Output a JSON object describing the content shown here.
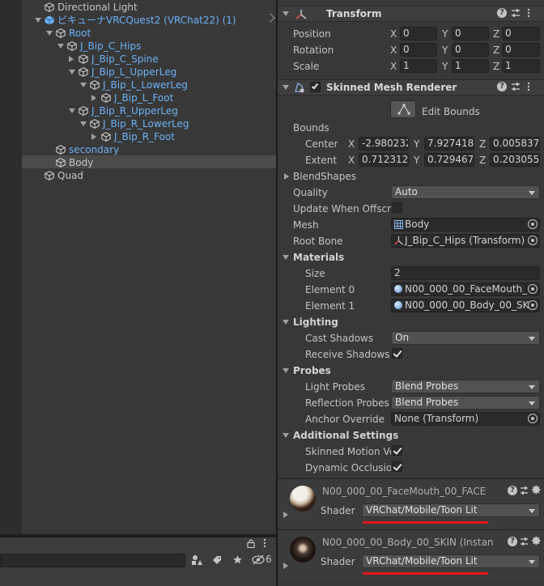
{
  "hierarchy": {
    "items": [
      {
        "label": "Directional Light",
        "depth": 0,
        "arrow": "none",
        "blue": false,
        "prefab": false,
        "selected": false
      },
      {
        "label": "ビキューナVRCQuest2 (VRChat22) (1)",
        "depth": 0,
        "arrow": "down",
        "blue": true,
        "prefab": true,
        "selected": false
      },
      {
        "label": "Root",
        "depth": 1,
        "arrow": "down",
        "blue": true,
        "prefab": false,
        "selected": false
      },
      {
        "label": "J_Bip_C_Hips",
        "depth": 2,
        "arrow": "down",
        "blue": true,
        "prefab": false,
        "selected": false
      },
      {
        "label": "J_Bip_C_Spine",
        "depth": 3,
        "arrow": "right",
        "blue": true,
        "prefab": false,
        "selected": false
      },
      {
        "label": "J_Bip_L_UpperLeg",
        "depth": 3,
        "arrow": "down",
        "blue": true,
        "prefab": false,
        "selected": false
      },
      {
        "label": "J_Bip_L_LowerLeg",
        "depth": 4,
        "arrow": "down",
        "blue": true,
        "prefab": false,
        "selected": false
      },
      {
        "label": "J_Bip_L_Foot",
        "depth": 5,
        "arrow": "right",
        "blue": true,
        "prefab": false,
        "selected": false
      },
      {
        "label": "J_Bip_R_UpperLeg",
        "depth": 3,
        "arrow": "down",
        "blue": true,
        "prefab": false,
        "selected": false
      },
      {
        "label": "J_Bip_R_LowerLeg",
        "depth": 4,
        "arrow": "down",
        "blue": true,
        "prefab": false,
        "selected": false
      },
      {
        "label": "J_Bip_R_Foot",
        "depth": 5,
        "arrow": "right",
        "blue": true,
        "prefab": false,
        "selected": false
      },
      {
        "label": "secondary",
        "depth": 1,
        "arrow": "none",
        "blue": true,
        "prefab": false,
        "selected": false
      },
      {
        "label": "Body",
        "depth": 1,
        "arrow": "none",
        "blue": false,
        "prefab": false,
        "selected": true
      },
      {
        "label": "Quad",
        "depth": 0,
        "arrow": "none",
        "blue": false,
        "prefab": false,
        "selected": false
      }
    ],
    "project_badge": "6"
  },
  "transform": {
    "title": "Transform",
    "rows": [
      {
        "label": "Position",
        "x": "0",
        "y": "0",
        "z": "0"
      },
      {
        "label": "Rotation",
        "x": "0",
        "y": "0",
        "z": "0"
      },
      {
        "label": "Scale",
        "x": "1",
        "y": "1",
        "z": "1"
      }
    ]
  },
  "axis": {
    "x": "X",
    "y": "Y",
    "z": "Z"
  },
  "smr": {
    "title": "Skinned Mesh Renderer",
    "edit_bounds": "Edit Bounds",
    "bounds_label": "Bounds",
    "center": {
      "label": "Center",
      "x": "-2.980232",
      "y": "7.927418€",
      "z": "0.005837"
    },
    "extent": {
      "label": "Extent",
      "x": "0.712312",
      "y": "0.729467",
      "z": "0.203055"
    },
    "blendshapes": "BlendShapes",
    "quality": {
      "label": "Quality",
      "value": "Auto"
    },
    "update_offscreen": {
      "label": "Update When Offscre"
    },
    "mesh": {
      "label": "Mesh",
      "value": "Body"
    },
    "root_bone": {
      "label": "Root Bone",
      "value": "J_Bip_C_Hips (Transform)"
    },
    "materials": {
      "title": "Materials",
      "size_label": "Size",
      "size": "2",
      "el0_label": "Element 0",
      "el0": "N00_000_00_FaceMouth_",
      "el1_label": "Element 1",
      "el1": "N00_000_00_Body_00_SK"
    },
    "lighting": {
      "title": "Lighting",
      "cast_label": "Cast Shadows",
      "cast": "On",
      "receive_label": "Receive Shadows"
    },
    "probes": {
      "title": "Probes",
      "light_label": "Light Probes",
      "light": "Blend Probes",
      "refl_label": "Reflection Probes",
      "refl": "Blend Probes",
      "anchor_label": "Anchor Override",
      "anchor": "None (Transform)"
    },
    "additional": {
      "title": "Additional Settings",
      "motion_label": "Skinned Motion Ve",
      "occlusion_label": "Dynamic Occlusio"
    }
  },
  "material_cards": [
    {
      "name": "N00_000_00_FaceMouth_00_FACE",
      "shader_label": "Shader",
      "shader": "VRChat/Mobile/Toon Lit"
    },
    {
      "name": "N00_000_00_Body_00_SKIN (Instan",
      "shader_label": "Shader",
      "shader": "VRChat/Mobile/Toon Lit"
    }
  ],
  "colors": {
    "accent_underline": "#e8141b",
    "hierarchy_blue": "#6cb0f4",
    "panel_bg": "#383838"
  }
}
